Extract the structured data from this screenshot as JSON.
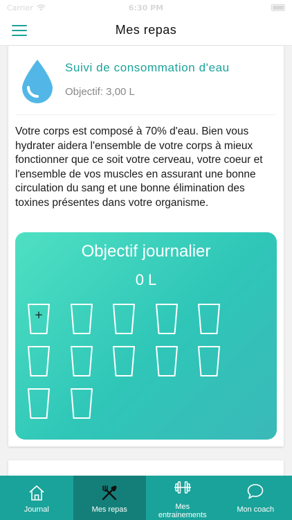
{
  "status_bar": {
    "carrier": "Carrier",
    "time": "6:30 PM"
  },
  "header": {
    "title": "Mes repas"
  },
  "card": {
    "title": "Suivi de consommation d'eau",
    "subtitle": "Objectif: 3,00 L",
    "description": "Votre corps est composé à 70% d'eau. Bien vous hydrater aidera l'ensemble de votre corps à mieux fonctionner que ce soit votre cerveau, votre coeur et l'ensemble de vos muscles en assurant une bonne circulation du sang et une bonne élimination des toxines présentes dans votre organisme."
  },
  "water_panel": {
    "title": "Objectif journalier",
    "value": "0 L",
    "glass_count": 12,
    "add_symbol": "+"
  },
  "tabs": [
    {
      "label": "Journal",
      "icon": "home-icon"
    },
    {
      "label": "Mes repas",
      "icon": "fork-knife-icon"
    },
    {
      "label": "Mes\nentrainements",
      "icon": "dumbbell-icon"
    },
    {
      "label": "Mon coach",
      "icon": "chat-bubble-icon"
    }
  ],
  "colors": {
    "accent": "#1aa39a",
    "tab_active": "#147f79",
    "drop": "#52b7e6"
  }
}
